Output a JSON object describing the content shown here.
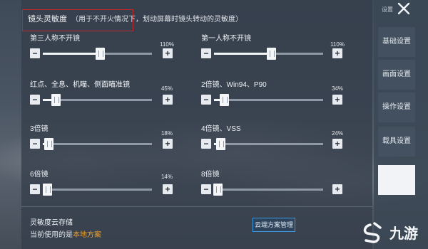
{
  "header": {
    "title": "镜头灵敏度",
    "note": "（用于不开火情况下，划动屏幕时镜头转动的灵敏度）"
  },
  "sliders": [
    {
      "label": "第三人称不开镜",
      "value": "110%",
      "level": 0.52
    },
    {
      "label": "第一人称不开镜",
      "value": "110%",
      "level": 0.52
    },
    {
      "label": "红点、全息、机瞄、侧面瞄准镜",
      "value": "45%",
      "level": 0.12
    },
    {
      "label": "2倍镜、Win94、P90",
      "value": "34%",
      "level": 0.09
    },
    {
      "label": "3倍镜",
      "value": "18%",
      "level": 0.05
    },
    {
      "label": "4倍镜、VSS",
      "value": "24%",
      "level": 0.06
    },
    {
      "label": "6倍镜",
      "value": "14%",
      "level": 0.04
    },
    {
      "label": "8倍镜",
      "value": "",
      "level": 0.03
    }
  ],
  "bottom": {
    "title": "灵敏度云存储",
    "current_prefix": "当前使用的是",
    "current_value": "本地方案",
    "cloud_button": "云端方案管理"
  },
  "sidebar": {
    "top_label": "设置",
    "tabs": [
      "基础设置",
      "画面设置",
      "操作设置",
      "载具设置",
      ""
    ]
  },
  "logo": {
    "text": "九游"
  },
  "colors": {
    "highlight": "#e8a032",
    "header_box": "#c0262c",
    "cloud_button_border": "#3e9be0"
  }
}
